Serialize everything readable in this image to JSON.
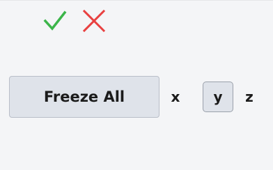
{
  "icons": {
    "confirm": {
      "name": "checkmark-icon",
      "color": "#3cb54a"
    },
    "cancel": {
      "name": "close-icon",
      "color": "#e84040"
    }
  },
  "toolbar": {
    "freeze_all_label": "Freeze All",
    "axes": {
      "x": "x",
      "y": "y",
      "z": "z",
      "selected": "y"
    }
  }
}
